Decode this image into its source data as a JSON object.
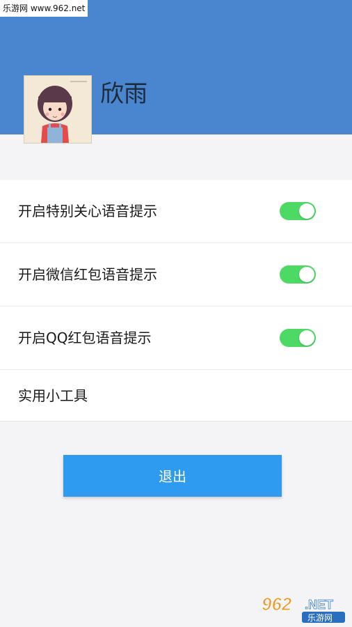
{
  "watermark": {
    "top_text": "乐游网 www.962.net",
    "logo_number": "962",
    "logo_suffix": ".NET",
    "logo_sub": "乐游网"
  },
  "profile": {
    "name": "欣雨",
    "avatar_icon": "cartoon-girl-avatar"
  },
  "settings": [
    {
      "label": "开启特别关心语音提示",
      "on": true
    },
    {
      "label": "开启微信红包语音提示",
      "on": true
    },
    {
      "label": "开启QQ红包语音提示",
      "on": true
    },
    {
      "label": "实用小工具"
    }
  ],
  "logout_label": "退出",
  "colors": {
    "header_bg": "#4a86cf",
    "toggle_on": "#4cd964",
    "button_bg": "#2e9af0",
    "page_bg": "#f4f4f6"
  }
}
